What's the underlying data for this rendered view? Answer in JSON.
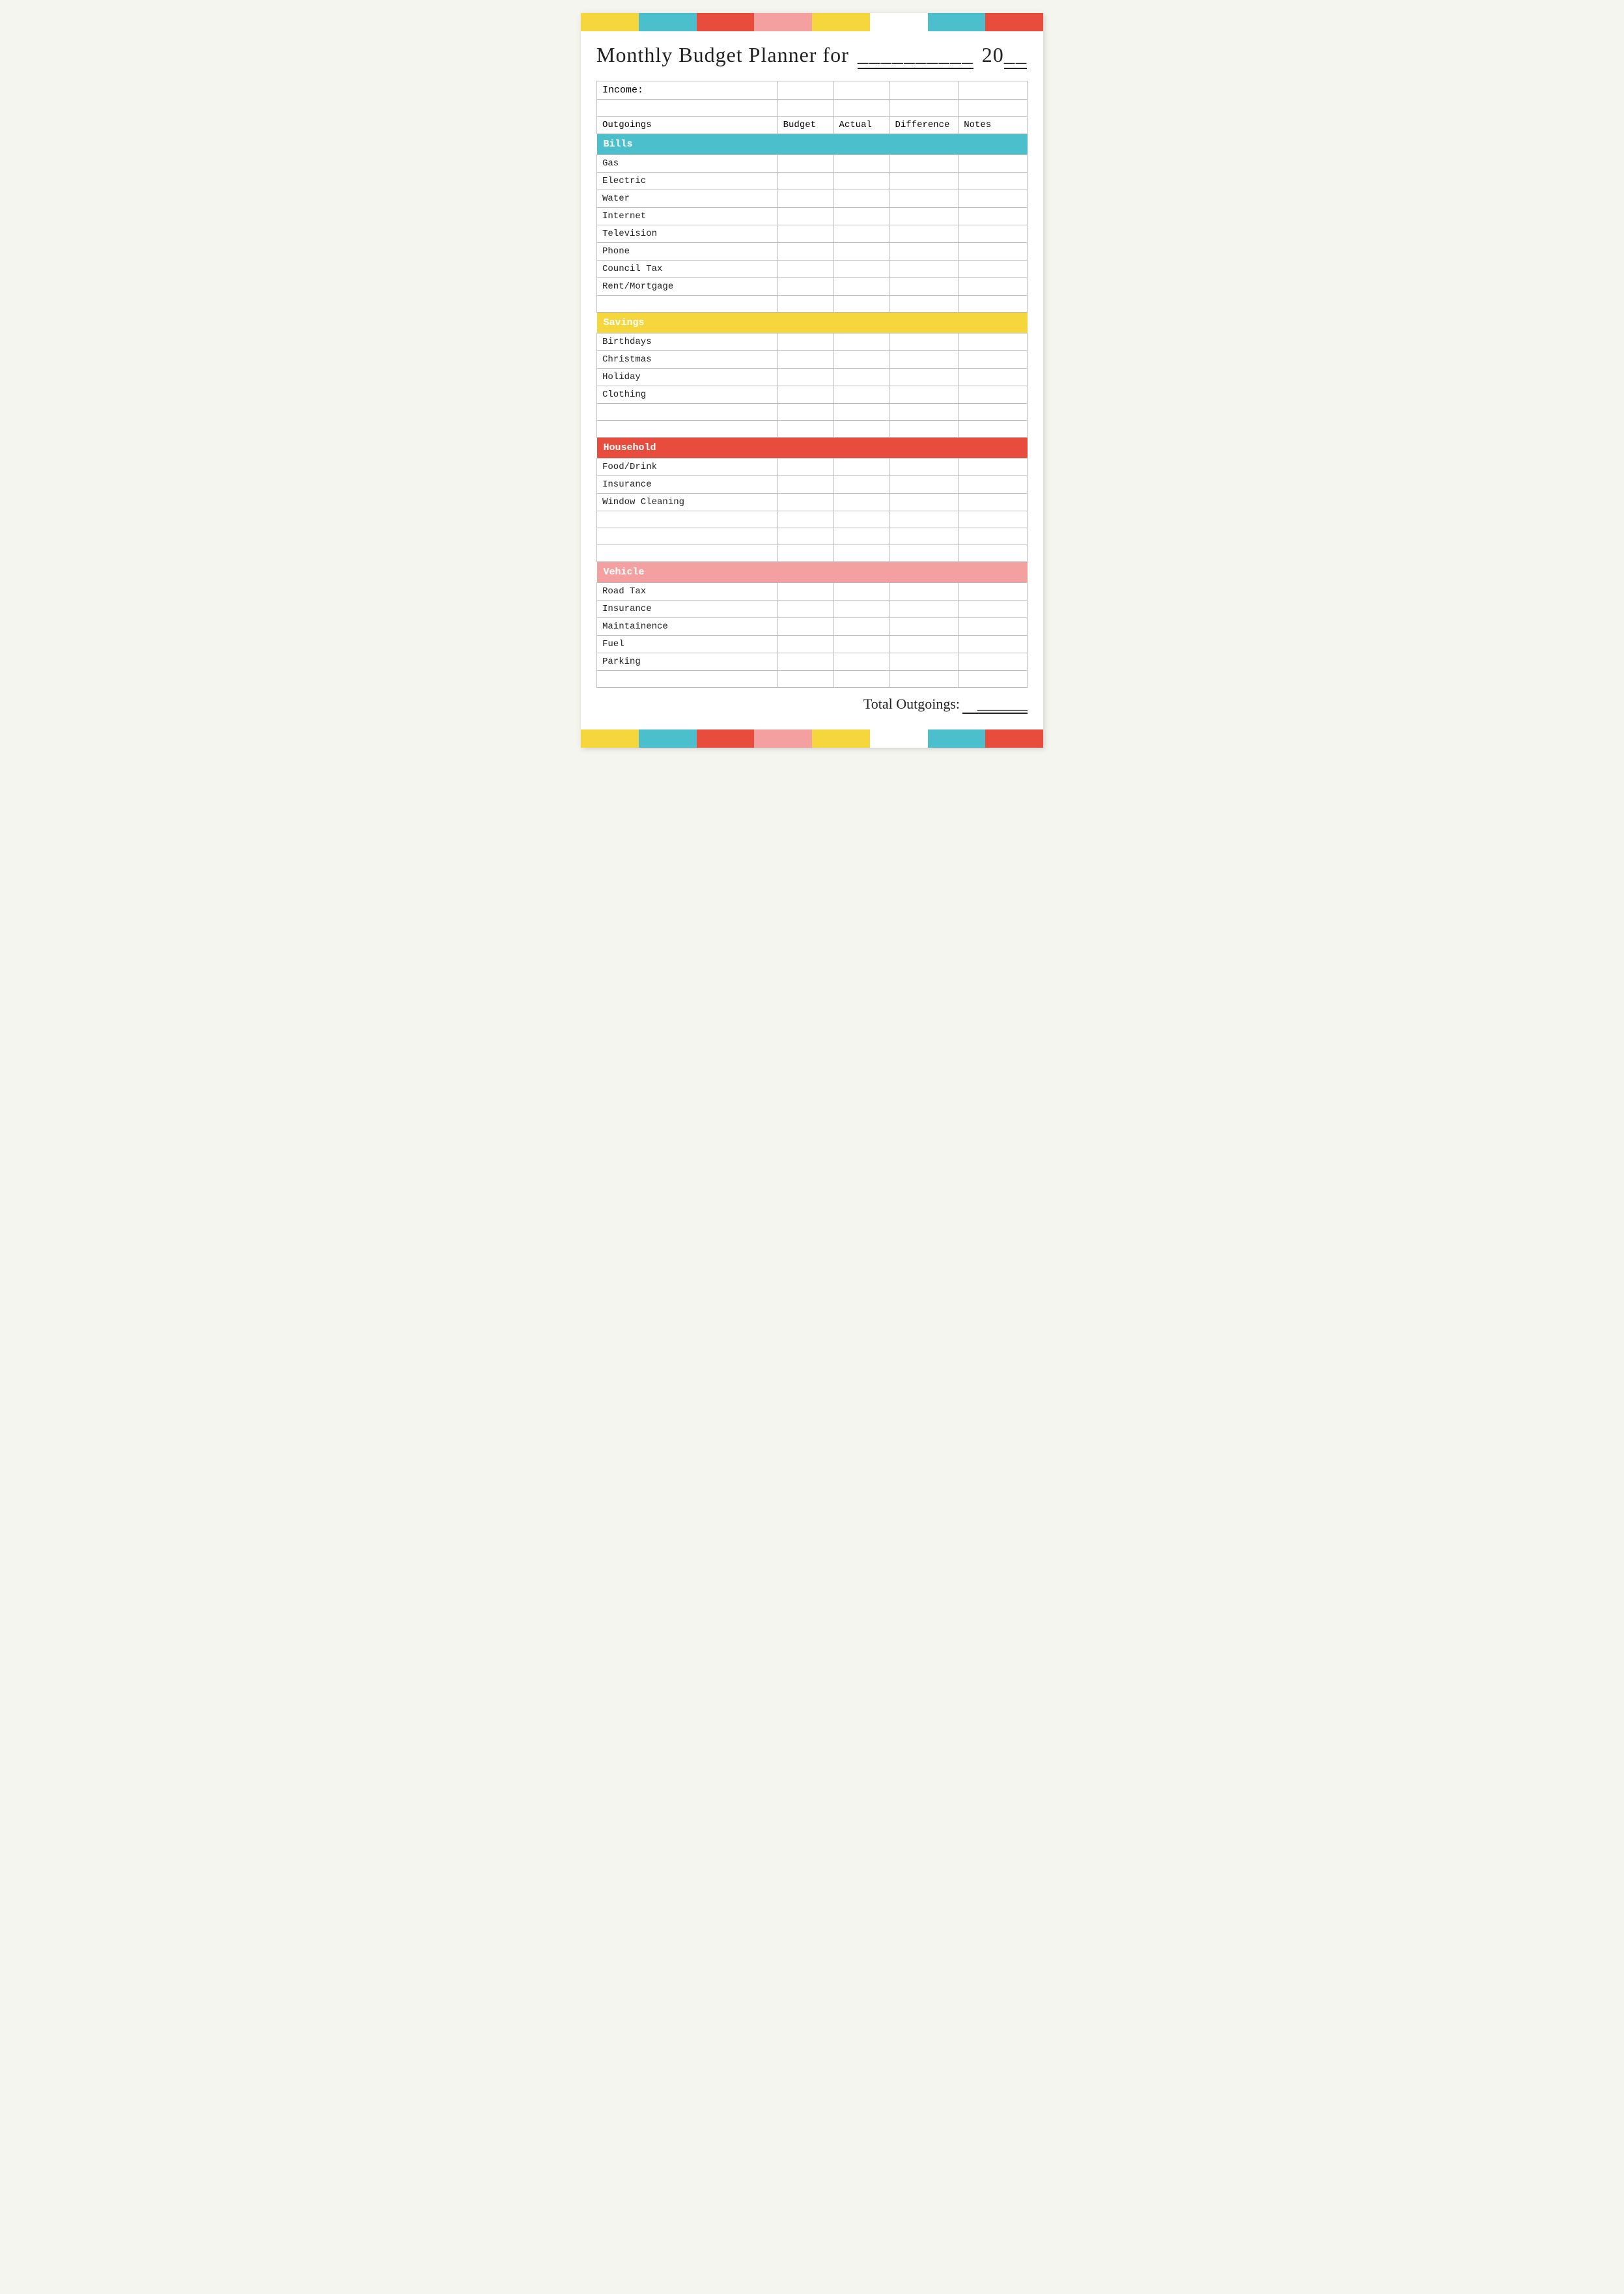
{
  "colorBar": {
    "segments": [
      {
        "class": "seg-yellow",
        "name": "yellow"
      },
      {
        "class": "seg-teal",
        "name": "teal"
      },
      {
        "class": "seg-red",
        "name": "red"
      },
      {
        "class": "seg-pink",
        "name": "pink"
      },
      {
        "class": "seg-yellow2",
        "name": "yellow2"
      },
      {
        "class": "seg-white",
        "name": "white"
      },
      {
        "class": "seg-teal2",
        "name": "teal2"
      },
      {
        "class": "seg-red2",
        "name": "red2"
      }
    ]
  },
  "title": {
    "text": "Monthly Budget Planner for",
    "monthBlank": "__________",
    "yearPrefix": "20",
    "yearBlank": "__"
  },
  "table": {
    "columns": [
      "Outgoings",
      "Budget",
      "Actual",
      "Difference",
      "Notes"
    ],
    "incomeLabel": "Income:",
    "categories": [
      {
        "name": "Bills",
        "colorClass": "cat-bills",
        "items": [
          "Gas",
          "Electric",
          "Water",
          "Internet",
          "Television",
          "Phone",
          "Council Tax",
          "Rent/Mortgage"
        ],
        "emptyRows": 1
      },
      {
        "name": "Savings",
        "colorClass": "cat-savings",
        "items": [
          "Birthdays",
          "Christmas",
          "Holiday",
          "Clothing"
        ],
        "emptyRows": 2
      },
      {
        "name": "Household",
        "colorClass": "cat-household",
        "items": [
          "Food/Drink",
          "Insurance",
          "Window Cleaning"
        ],
        "emptyRows": 3
      },
      {
        "name": "Vehicle",
        "colorClass": "cat-vehicle",
        "items": [
          "Road Tax",
          "Insurance",
          "Maintainence",
          "Fuel",
          "Parking"
        ],
        "emptyRows": 1
      }
    ],
    "totalLabel": "Total Outgoings:",
    "totalBlank": "_______"
  }
}
